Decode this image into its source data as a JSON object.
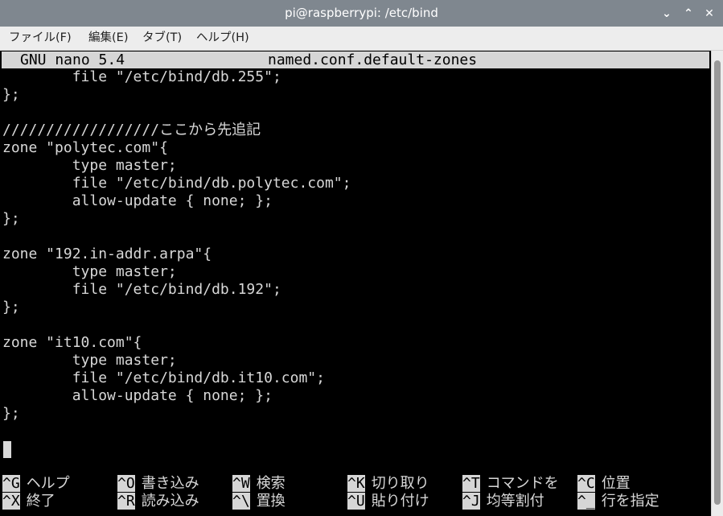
{
  "window": {
    "title": "pi@raspberrypi: /etc/bind",
    "buttons": {
      "minimize": "⌄",
      "maximize": "⌃",
      "close": "✕"
    }
  },
  "menubar": {
    "items": [
      "ファイル(F)",
      "編集(E)",
      "タブ(T)",
      "ヘルプ(H)"
    ]
  },
  "nano": {
    "version": "GNU nano 5.4",
    "filename": "named.conf.default-zones"
  },
  "editor": {
    "lines": [
      "        file \"/etc/bind/db.255\";",
      "};",
      "",
      "//////////////////ここから先追記",
      "zone \"polytec.com\"{",
      "        type master;",
      "        file \"/etc/bind/db.polytec.com\";",
      "        allow-update { none; };",
      "};",
      "",
      "zone \"192.in-addr.arpa\"{",
      "        type master;",
      "        file \"/etc/bind/db.192\";",
      "};",
      "",
      "zone \"it10.com\"{",
      "        type master;",
      "        file \"/etc/bind/db.it10.com\";",
      "        allow-update { none; };",
      "};"
    ]
  },
  "shortcuts": {
    "row1": [
      {
        "key": "^G",
        "label": "ヘルプ"
      },
      {
        "key": "^O",
        "label": "書き込み"
      },
      {
        "key": "^W",
        "label": "検索"
      },
      {
        "key": "^K",
        "label": "切り取り"
      },
      {
        "key": "^T",
        "label": "コマンドを"
      },
      {
        "key": "^C",
        "label": "位置"
      }
    ],
    "row2": [
      {
        "key": "^X",
        "label": "終了"
      },
      {
        "key": "^R",
        "label": "読み込み"
      },
      {
        "key": "^\\",
        "label": "置換"
      },
      {
        "key": "^U",
        "label": "貼り付け"
      },
      {
        "key": "^J",
        "label": "均等割付"
      },
      {
        "key": "^_",
        "label": "行を指定"
      }
    ]
  },
  "colors": {
    "titlebar": "#7f878f",
    "menubar": "#ededed",
    "terminal_bg": "#000000",
    "terminal_fg": "#d8d8d8",
    "header_bg": "#d6d6d6"
  }
}
